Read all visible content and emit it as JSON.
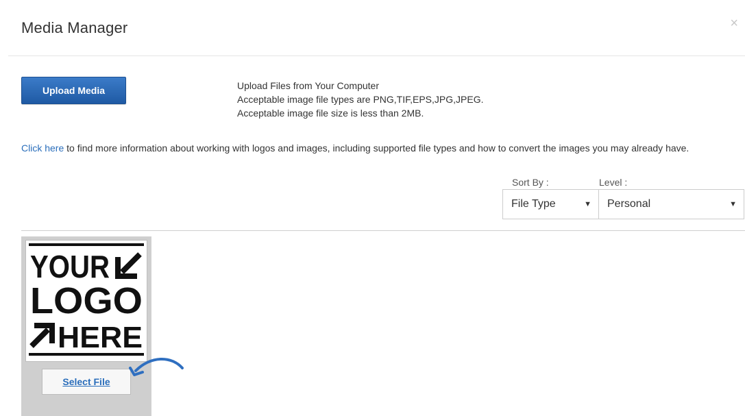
{
  "modal": {
    "title": "Media Manager",
    "close_glyph": "×"
  },
  "upload": {
    "button_label": "Upload Media",
    "info_lines": [
      "Upload Files from Your Computer",
      "Acceptable image file types are PNG,TIF,EPS,JPG,JPEG.",
      "Acceptable image file size is less than 2MB."
    ]
  },
  "info": {
    "link_text": "Click here",
    "rest_text": " to find more information about working with logos and images, including supported file types and how to convert the images you may already have."
  },
  "filters": {
    "sort_label": "Sort By :",
    "sort_value": "File Type",
    "level_label": "Level :",
    "level_value": "Personal"
  },
  "media_item": {
    "logo_lines": [
      "YOUR",
      "LOGO",
      "HERE"
    ],
    "select_label": "Select File"
  },
  "colors": {
    "primary_button": "#2a64b0",
    "link": "#2a6ebb",
    "tile_bg": "#cfcfcf",
    "annotation_arrow": "#2f6fc0"
  }
}
